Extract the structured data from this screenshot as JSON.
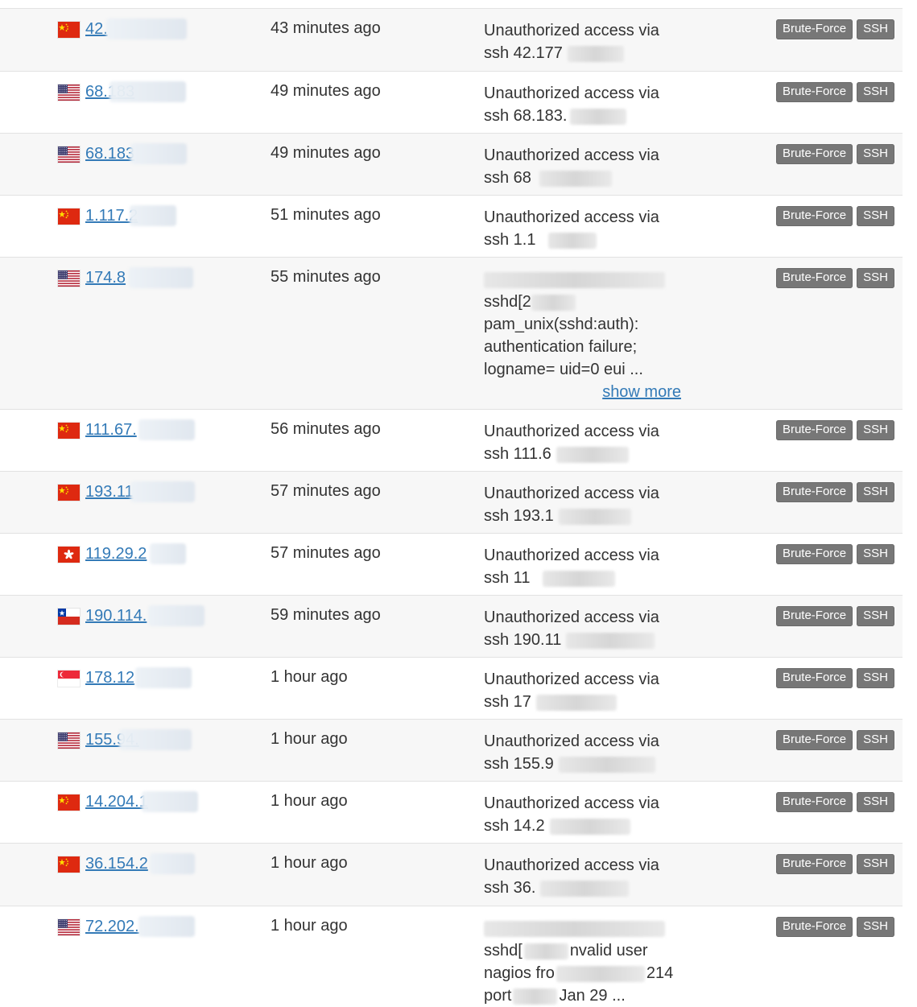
{
  "rows": [
    {
      "ip": "42.",
      "flag": "cn",
      "time": "43 minutes ago",
      "comment": [
        "Unauthorized access via",
        "ssh 42.177"
      ],
      "tags": [
        "Brute-Force",
        "SSH"
      ]
    },
    {
      "ip": "68.183",
      "flag": "us",
      "time": "49 minutes ago",
      "comment": [
        "Unauthorized access via",
        "ssh 68.183."
      ],
      "tags": [
        "Brute-Force",
        "SSH"
      ]
    },
    {
      "ip": "68.183",
      "flag": "us",
      "time": "49 minutes ago",
      "comment": [
        "Unauthorized access via",
        "ssh 68"
      ],
      "tags": [
        "Brute-Force",
        "SSH"
      ]
    },
    {
      "ip": "1.117.2",
      "flag": "cn",
      "time": "51 minutes ago",
      "comment": [
        "Unauthorized access via",
        "ssh 1.1"
      ],
      "tags": [
        "Brute-Force",
        "SSH"
      ]
    },
    {
      "ip": "174.8",
      "flag": "us",
      "time": "55 minutes ago",
      "comment": [
        "",
        "sshd[2",
        "pam_unix(sshd:auth):",
        "authentication failure;",
        "logname= uid=0 eui ..."
      ],
      "show_more": "show more",
      "tags": [
        "Brute-Force",
        "SSH"
      ]
    },
    {
      "ip": "111.67.",
      "flag": "cn",
      "time": "56 minutes ago",
      "comment": [
        "Unauthorized access via",
        "ssh 111.6"
      ],
      "tags": [
        "Brute-Force",
        "SSH"
      ]
    },
    {
      "ip": "193.11",
      "flag": "cn",
      "time": "57 minutes ago",
      "comment": [
        "Unauthorized access via",
        "ssh 193.1"
      ],
      "tags": [
        "Brute-Force",
        "SSH"
      ]
    },
    {
      "ip": "119.29.2",
      "flag": "hk",
      "time": "57 minutes ago",
      "comment": [
        "Unauthorized access via",
        "ssh 11"
      ],
      "tags": [
        "Brute-Force",
        "SSH"
      ]
    },
    {
      "ip": "190.114.",
      "flag": "cl",
      "time": "59 minutes ago",
      "comment": [
        "Unauthorized access via",
        "ssh 190.11"
      ],
      "tags": [
        "Brute-Force",
        "SSH"
      ]
    },
    {
      "ip": "178.12",
      "flag": "sg",
      "time": "1 hour ago",
      "comment": [
        "Unauthorized access via",
        "ssh 17"
      ],
      "tags": [
        "Brute-Force",
        "SSH"
      ]
    },
    {
      "ip": "155.94.",
      "flag": "us",
      "time": "1 hour ago",
      "comment": [
        "Unauthorized access via",
        "ssh 155.9"
      ],
      "tags": [
        "Brute-Force",
        "SSH"
      ]
    },
    {
      "ip": "14.204.1",
      "flag": "cn",
      "time": "1 hour ago",
      "comment": [
        "Unauthorized access via",
        "ssh 14.2"
      ],
      "tags": [
        "Brute-Force",
        "SSH"
      ]
    },
    {
      "ip": "36.154.2",
      "flag": "cn",
      "time": "1 hour ago",
      "comment": [
        "Unauthorized access via",
        "ssh 36."
      ],
      "tags": [
        "Brute-Force",
        "SSH"
      ]
    },
    {
      "ip": "72.202.",
      "flag": "us",
      "time": "1 hour ago",
      "comment": [
        "",
        "sshd[",
        "nagios fro",
        "port"
      ],
      "comment_tails": [
        "",
        "nvalid user",
        "214",
        "Jan 29 ..."
      ],
      "tags": [
        "Brute-Force",
        "SSH"
      ]
    }
  ],
  "colors": {
    "link": "#337ab7",
    "tag_bg": "#777777",
    "row_alt": "#f7f7f7"
  }
}
